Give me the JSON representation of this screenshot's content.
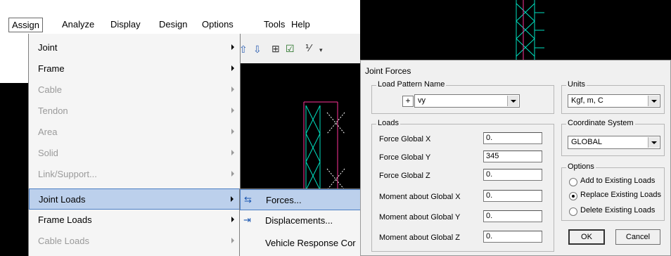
{
  "menubar": {
    "items": [
      "Assign",
      "Analyze",
      "Display",
      "Design",
      "Options",
      "Tools",
      "Help"
    ]
  },
  "assign_menu": {
    "items": [
      {
        "label": "Joint",
        "enabled": true
      },
      {
        "label": "Frame",
        "enabled": true
      },
      {
        "label": "Cable",
        "enabled": false
      },
      {
        "label": "Tendon",
        "enabled": false
      },
      {
        "label": "Area",
        "enabled": false
      },
      {
        "label": "Solid",
        "enabled": false
      },
      {
        "label": "Link/Support...",
        "enabled": false
      },
      {
        "label": "Joint Loads",
        "enabled": true,
        "highlighted": true
      },
      {
        "label": "Frame Loads",
        "enabled": true
      },
      {
        "label": "Cable Loads",
        "enabled": false
      }
    ]
  },
  "joint_loads_submenu": {
    "items": [
      "Forces...",
      "Displacements...",
      "Vehicle Response Cor"
    ]
  },
  "dialog": {
    "title": "Joint Forces",
    "load_pattern": {
      "group_title": "Load Pattern Name",
      "plus": "+",
      "value": "vy"
    },
    "units": {
      "group_title": "Units",
      "value": "Kgf, m, C"
    },
    "loads": {
      "group_title": "Loads",
      "rows": [
        {
          "label": "Force Global X",
          "value": "0."
        },
        {
          "label": "Force Global Y",
          "value": "345"
        },
        {
          "label": "Force Global Z",
          "value": "0."
        },
        {
          "label": "Moment about Global X",
          "value": "0."
        },
        {
          "label": "Moment about Global Y",
          "value": "0."
        },
        {
          "label": "Moment about Global Z",
          "value": "0."
        }
      ]
    },
    "coordinate_system": {
      "group_title": "Coordinate System",
      "value": "GLOBAL"
    },
    "options": {
      "group_title": "Options",
      "items": [
        "Add to Existing Loads",
        "Replace Existing Loads",
        "Delete Existing Loads"
      ],
      "selected": "Replace Existing Loads"
    },
    "ok_label": "OK",
    "cancel_label": "Cancel"
  },
  "colors": {
    "highlight": "#bcd0ec",
    "structure": "#00e0c0",
    "frame_red": "#ff3399"
  }
}
